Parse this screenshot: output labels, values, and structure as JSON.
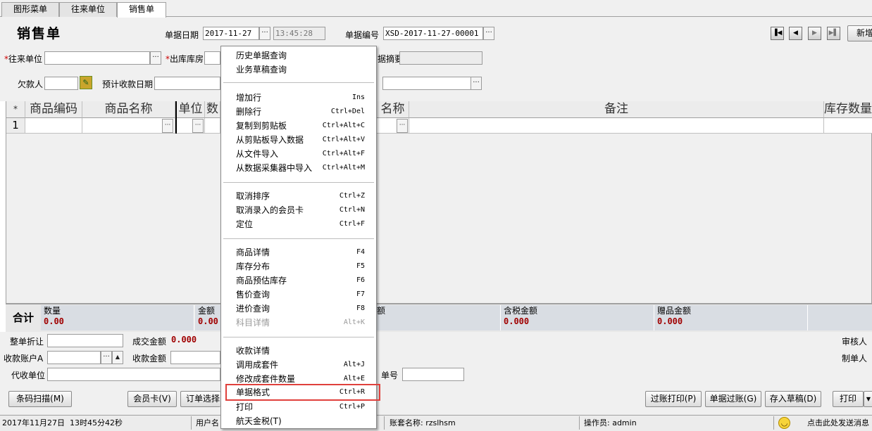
{
  "tabs": [
    {
      "label": "图形菜单"
    },
    {
      "label": "往来单位"
    },
    {
      "label": "销售单"
    }
  ],
  "header": {
    "title": "销售单",
    "date_label": "单据日期",
    "date_value": "2017-11-27",
    "time_value": "13:45:28",
    "docno_label": "单据编号",
    "docno_value": "XSD-2017-11-27-00001",
    "nav": {
      "first": "first-icon",
      "prev": "prev-icon",
      "next": "next-icon",
      "last": "last-icon"
    },
    "new_button": "新增"
  },
  "form": {
    "customer_label": "往来单位",
    "warehouse_label": "出库库房",
    "summary_label": "据摘要",
    "debtor_label": "欠款人",
    "due_date_label": "预计收款日期"
  },
  "grid": {
    "columns": [
      "*",
      "商品编码",
      "商品名称",
      "单位",
      "数",
      "名称",
      "备注",
      "库存数量"
    ],
    "row_no": "1"
  },
  "totals": {
    "label": "合计",
    "cells": [
      {
        "label": "数量",
        "value": "0.00"
      },
      {
        "label": "金额",
        "value": "0.00"
      },
      {
        "label": "额",
        "value": ""
      },
      {
        "label": "含税金额",
        "value": "0.000"
      },
      {
        "label": "赠品金额",
        "value": "0.000"
      }
    ]
  },
  "lower": {
    "discount_label": "整单折让",
    "deal_amount_label": "成交金额",
    "deal_amount_value": "0.000",
    "account_label": "收款账户A",
    "receive_amount_label": "收款金额",
    "agent_label": "代收单位",
    "doc_no_label": "单号",
    "auditor_label": "审核人",
    "maker_label": "制单人"
  },
  "buttons": {
    "barcode": "条码扫描(M)",
    "member_card": "会员卡(V)",
    "order_select": "订单选择",
    "post_print": "过账打印(P)",
    "post": "单据过账(G)",
    "save_draft": "存入草稿(D)",
    "print": "打印"
  },
  "status": {
    "datetime": "2017年11月27日  13时45分42秒",
    "user_label": "用户名",
    "account_set": "账套名称: rzslhsm",
    "operator": "操作员: admin",
    "hint": "点击此处发送消息"
  },
  "context_menu": {
    "items": [
      {
        "label": "历史单据查询",
        "shortcut": ""
      },
      {
        "label": "业务草稿查询",
        "shortcut": ""
      },
      {
        "label": "增加行",
        "shortcut": "Ins"
      },
      {
        "label": "删除行",
        "shortcut": "Ctrl+Del"
      },
      {
        "label": "复制到剪贴板",
        "shortcut": "Ctrl+Alt+C"
      },
      {
        "label": "从剪贴板导入数据",
        "shortcut": "Ctrl+Alt+V"
      },
      {
        "label": "从文件导入",
        "shortcut": "Ctrl+Alt+F"
      },
      {
        "label": "从数据采集器中导入",
        "shortcut": "Ctrl+Alt+M"
      },
      {
        "label": "取消排序",
        "shortcut": "Ctrl+Z"
      },
      {
        "label": "取消录入的会员卡",
        "shortcut": "Ctrl+N"
      },
      {
        "label": "定位",
        "shortcut": "Ctrl+F"
      },
      {
        "label": "商品详情",
        "shortcut": "F4"
      },
      {
        "label": "库存分布",
        "shortcut": "F5"
      },
      {
        "label": "商品预估库存",
        "shortcut": "F6"
      },
      {
        "label": "售价查询",
        "shortcut": "F7"
      },
      {
        "label": "进价查询",
        "shortcut": "F8"
      },
      {
        "label": "科目详情",
        "shortcut": "Alt+K",
        "disabled": true
      },
      {
        "label": "收款详情",
        "shortcut": ""
      },
      {
        "label": "调用成套件",
        "shortcut": "Alt+J"
      },
      {
        "label": "修改成套件数量",
        "shortcut": "Alt+E"
      },
      {
        "label": "单据格式",
        "shortcut": "Ctrl+R",
        "highlighted": true
      },
      {
        "label": "打印",
        "shortcut": "Ctrl+P"
      },
      {
        "label": "航天金税(T)",
        "shortcut": ""
      }
    ]
  },
  "colors": {
    "highlight": "#e0403c",
    "amount": "#a00000",
    "required": "#cc0000"
  }
}
